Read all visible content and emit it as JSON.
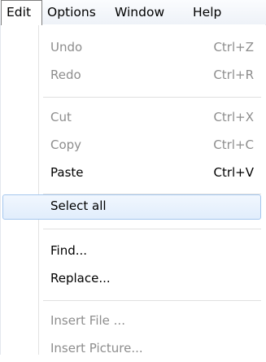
{
  "menubar": {
    "items": [
      "Edit",
      "Options",
      "Window",
      "Help"
    ]
  },
  "edit_menu": {
    "undo": {
      "label": "Undo",
      "shortcut": "Ctrl+Z"
    },
    "redo": {
      "label": "Redo",
      "shortcut": "Ctrl+R"
    },
    "cut": {
      "label": "Cut",
      "shortcut": "Ctrl+X"
    },
    "copy": {
      "label": "Copy",
      "shortcut": "Ctrl+C"
    },
    "paste": {
      "label": "Paste",
      "shortcut": "Ctrl+V"
    },
    "select_all": {
      "label": "Select all"
    },
    "find": {
      "label": "Find..."
    },
    "replace": {
      "label": "Replace..."
    },
    "insert_file": {
      "label": "Insert File ..."
    },
    "insert_picture": {
      "label": "Insert Picture..."
    }
  },
  "colors": {
    "disabled_text": "#8d8d8d",
    "highlight_border": "#a5c7ee",
    "highlight_fill": "#e1edfc"
  }
}
